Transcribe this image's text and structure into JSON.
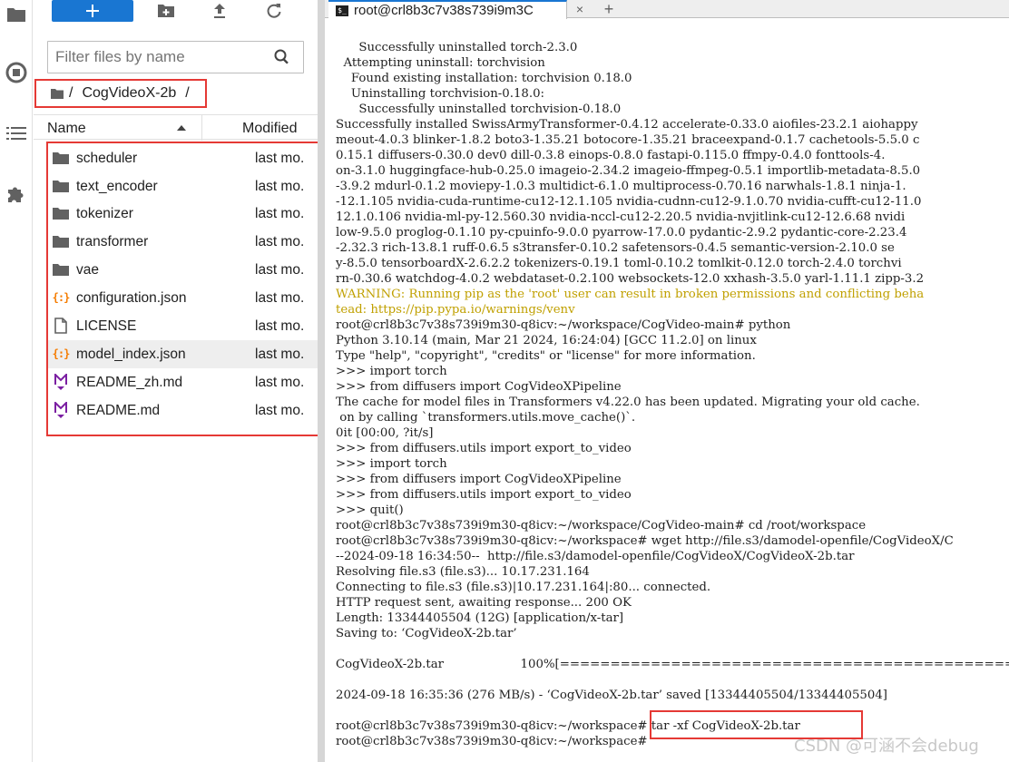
{
  "activity_bar": {
    "icons": [
      "folder-icon",
      "running-icon",
      "table-of-contents-icon",
      "extension-icon"
    ]
  },
  "toolbar": {
    "new_label": "+"
  },
  "file_browser": {
    "filter_placeholder": "Filter files by name",
    "breadcrumb": {
      "root": "/",
      "folder": "CogVideoX-2b",
      "trailing": "/"
    },
    "columns": {
      "name": "Name",
      "modified": "Modified"
    },
    "files": [
      {
        "name": "scheduler",
        "modified": "last mo.",
        "type": "folder"
      },
      {
        "name": "text_encoder",
        "modified": "last mo.",
        "type": "folder"
      },
      {
        "name": "tokenizer",
        "modified": "last mo.",
        "type": "folder"
      },
      {
        "name": "transformer",
        "modified": "last mo.",
        "type": "folder"
      },
      {
        "name": "vae",
        "modified": "last mo.",
        "type": "folder"
      },
      {
        "name": "configuration.json",
        "modified": "last mo.",
        "type": "json"
      },
      {
        "name": "LICENSE",
        "modified": "last mo.",
        "type": "file"
      },
      {
        "name": "model_index.json",
        "modified": "last mo.",
        "type": "json"
      },
      {
        "name": "README_zh.md",
        "modified": "last mo.",
        "type": "markdown"
      },
      {
        "name": "README.md",
        "modified": "last mo.",
        "type": "markdown"
      }
    ]
  },
  "terminal_tab": {
    "title": "root@crl8b3c7v38s739i9m3C",
    "close": "×",
    "add": "+"
  },
  "terminal": {
    "lines": [
      "      Successfully uninstalled torch-2.3.0",
      "  Attempting uninstall: torchvision",
      "    Found existing installation: torchvision 0.18.0",
      "    Uninstalling torchvision-0.18.0:",
      "      Successfully uninstalled torchvision-0.18.0",
      "Successfully installed SwissArmyTransformer-0.4.12 accelerate-0.33.0 aiofiles-23.2.1 aiohappy",
      "meout-4.0.3 blinker-1.8.2 boto3-1.35.21 botocore-1.35.21 braceexpand-0.1.7 cachetools-5.5.0 c",
      "0.15.1 diffusers-0.30.0 dev0 dill-0.3.8 einops-0.8.0 fastapi-0.115.0 ffmpy-0.4.0 fonttools-4.",
      "on-3.1.0 huggingface-hub-0.25.0 imageio-2.34.2 imageio-ffmpeg-0.5.1 importlib-metadata-8.5.0",
      "-3.9.2 mdurl-0.1.2 moviepy-1.0.3 multidict-6.1.0 multiprocess-0.70.16 narwhals-1.8.1 ninja-1.",
      "-12.1.105 nvidia-cuda-runtime-cu12-12.1.105 nvidia-cudnn-cu12-9.1.0.70 nvidia-cufft-cu12-11.0",
      "12.1.0.106 nvidia-ml-py-12.560.30 nvidia-nccl-cu12-2.20.5 nvidia-nvjitlink-cu12-12.6.68 nvidi",
      "low-9.5.0 proglog-0.1.10 py-cpuinfo-9.0.0 pyarrow-17.0.0 pydantic-2.9.2 pydantic-core-2.23.4",
      "-2.32.3 rich-13.8.1 ruff-0.6.5 s3transfer-0.10.2 safetensors-0.4.5 semantic-version-2.10.0 se",
      "y-8.5.0 tensorboardX-2.6.2.2 tokenizers-0.19.1 toml-0.10.2 tomlkit-0.12.0 torch-2.4.0 torchvi",
      "rn-0.30.6 watchdog-4.0.2 webdataset-0.2.100 websockets-12.0 xxhash-3.5.0 yarl-1.11.1 zipp-3.2",
      "WARNING: Running pip as the 'root' user can result in broken permissions and conflicting beha",
      "tead: https://pip.pypa.io/warnings/venv",
      "root@crl8b3c7v38s739i9m30-q8icv:~/workspace/CogVideo-main# python",
      "Python 3.10.14 (main, Mar 21 2024, 16:24:04) [GCC 11.2.0] on linux",
      "Type \"help\", \"copyright\", \"credits\" or \"license\" for more information.",
      ">>> import torch",
      ">>> from diffusers import CogVideoXPipeline",
      "The cache for model files in Transformers v4.22.0 has been updated. Migrating your old cache.",
      " on by calling `transformers.utils.move_cache()`.",
      "0it [00:00, ?it/s]",
      ">>> from diffusers.utils import export_to_video",
      ">>> import torch",
      ">>> from diffusers import CogVideoXPipeline",
      ">>> from diffusers.utils import export_to_video",
      ">>> quit()",
      "root@crl8b3c7v38s739i9m30-q8icv:~/workspace/CogVideo-main# cd /root/workspace",
      "root@crl8b3c7v38s739i9m30-q8icv:~/workspace# wget http://file.s3/damodel-openfile/CogVideoX/C",
      "--2024-09-18 16:34:50--  http://file.s3/damodel-openfile/CogVideoX/CogVideoX-2b.tar",
      "Resolving file.s3 (file.s3)... 10.17.231.164",
      "Connecting to file.s3 (file.s3)|10.17.231.164|:80... connected.",
      "HTTP request sent, awaiting response... 200 OK",
      "Length: 13344405504 (12G) [application/x-tar]",
      "Saving to: ‘CogVideoX-2b.tar’",
      "",
      "CogVideoX-2b.tar                    100%[==================================================",
      "",
      "2024-09-18 16:35:36 (276 MB/s) - ‘CogVideoX-2b.tar’ saved [13344405504/13344405504]",
      "",
      "root@crl8b3c7v38s739i9m30-q8icv:~/workspace# tar -xf CogVideoX-2b.tar",
      "root@crl8b3c7v38s739i9m30-q8icv:~/workspace# "
    ],
    "warning_lines": [
      16,
      17
    ]
  },
  "watermark": "CSDN @可涵不会debug"
}
